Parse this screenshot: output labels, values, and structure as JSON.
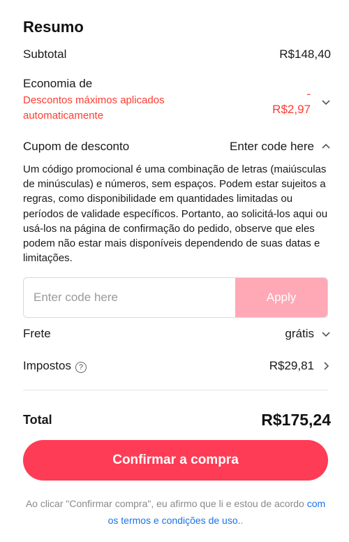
{
  "summary": {
    "title": "Resumo",
    "subtotal_label": "Subtotal",
    "subtotal_value": "R$148,40",
    "economia_label": "Economia de",
    "economia_sub": "Descontos máximos aplicados automaticamente",
    "economia_value_sign": "-",
    "economia_value": "R$2,97",
    "cupom_label": "Cupom de desconto",
    "cupom_value": "Enter code here",
    "cupom_description": "Um código promocional é uma combinação de letras (maiúsculas de minúsculas) e números, sem espaços. Podem estar sujeitos a regras, como disponibilidade em quantidades limitadas ou períodos de validade específicos. Portanto, ao solicitá-los aqui ou usá-los na página de confirmação do pedido, observe que eles podem não estar mais disponíveis dependendo de suas datas e limitações.",
    "code_placeholder": "Enter code here",
    "apply_label": "Apply",
    "frete_label": "Frete",
    "frete_value": "grátis",
    "impostos_label": "Impostos",
    "impostos_help": "?",
    "impostos_value": "R$29,81",
    "total_label": "Total",
    "total_value": "R$175,24",
    "confirm_label": "Confirmar a compra",
    "footer_text": "Ao clicar \"Confirmar compra\", eu afirmo que li e estou de acordo ",
    "footer_link": "com os termos e condições de uso.",
    "footer_end": "."
  },
  "colors": {
    "accent": "#ff3c55",
    "discount": "#ff3b30",
    "apply_disabled": "#ffa8b6",
    "link": "#1a73e8"
  },
  "icons": {
    "expand": "chevron-down-icon",
    "collapse": "chevron-up-icon",
    "navigate": "chevron-right-icon",
    "help": "question-circle-icon"
  }
}
